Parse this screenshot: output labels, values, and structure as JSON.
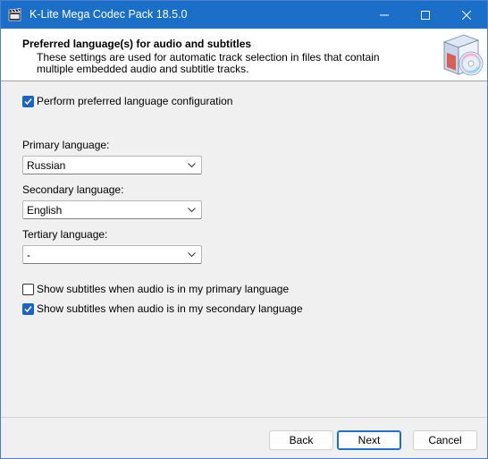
{
  "window": {
    "title": "K-Lite Mega Codec Pack 18.5.0",
    "icon": "film-clapper-icon",
    "titlebar_color": "#1c6fc9"
  },
  "header": {
    "title": "Preferred language(s) for audio and subtitles",
    "description": "These settings are used for automatic track selection in files that contain multiple embedded audio and subtitle tracks.",
    "image": "software-box-cd-icon"
  },
  "options": {
    "perform_config": {
      "label": "Perform preferred language configuration",
      "checked": true
    },
    "primary": {
      "label": "Primary language:",
      "value": "Russian"
    },
    "secondary": {
      "label": "Secondary language:",
      "value": "English"
    },
    "tertiary": {
      "label": "Tertiary language:",
      "value": "-"
    },
    "show_subs_primary": {
      "label": "Show subtitles when audio is in my primary language",
      "checked": false
    },
    "show_subs_secondary": {
      "label": "Show subtitles when audio is in my secondary language",
      "checked": true
    }
  },
  "buttons": {
    "back": "Back",
    "next": "Next",
    "cancel": "Cancel"
  },
  "accent": "#1a63c7"
}
